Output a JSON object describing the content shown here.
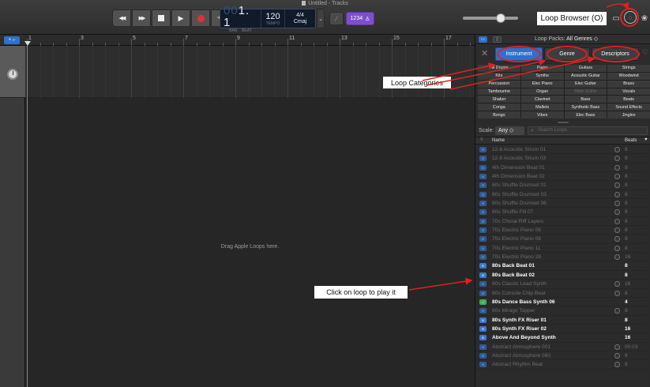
{
  "window": {
    "title": "Untitled - Tracks"
  },
  "transport": {
    "buttons": [
      "rewind",
      "fast-forward",
      "stop",
      "play",
      "record",
      "cycle"
    ],
    "glyphs": {
      "rewind": "◀◀",
      "fast_forward": "▶▶",
      "play": "▶",
      "cycle": "⟲"
    }
  },
  "lcd": {
    "position_dim": "00",
    "position_bar": "1",
    "position_beat": ". 1",
    "bar_label": "BAR",
    "beat_label": "BEAT",
    "tempo": "120",
    "tempo_label": "TEMPO",
    "time_sig": "4/4",
    "key": "Cmaj",
    "chevron": "⌄"
  },
  "toolbar": {
    "tuner_glyph": "⁄",
    "count_in": "1234",
    "metronome": "♙",
    "loop_browser_callout": "Loop Browser (O)",
    "notepad_glyph": "▭",
    "loop_browser_glyph": "◌",
    "media_glyph": "❀"
  },
  "ruler": {
    "marks": [
      "1",
      "3",
      "5",
      "7",
      "9",
      "11",
      "13",
      "15",
      "17"
    ]
  },
  "tracks": {
    "add_track": "+ ⌐",
    "drag_hint": "Drag Apple Loops here."
  },
  "annotations": {
    "loop_categories": "Loop Categories",
    "click_loop": "Click on loop to play it"
  },
  "browser": {
    "loop_packs_label": "Loop Packs:",
    "loop_packs_value": "All Genres ◇",
    "close_glyph": "✕",
    "heart_glyph": "♡",
    "tabs": [
      "Instrument",
      "Genre",
      "Descriptors"
    ],
    "categories": [
      "All Drums",
      "Piano",
      "Guitars",
      "Strings",
      "Kits",
      "Synths",
      "Acoustic Guitar",
      "Woodwind",
      "Percussion",
      "Elec Piano",
      "Elec Guitar",
      "Brass",
      "Tambourine",
      "Organ",
      "Slide Guitar",
      "Vocals",
      "Shaker",
      "Clavinet",
      "Bass",
      "Beats",
      "Conga",
      "Mallets",
      "Synthetic Bass",
      "Sound Effects",
      "Bongo",
      "Vibes",
      "Elec Bass",
      "Jingles"
    ],
    "dim_categories": [
      "Slide Guitar"
    ],
    "scale_label": "Scale:",
    "scale_value": "Any  ◇",
    "search_placeholder": "Search Loops",
    "search_glyph": "⌕",
    "columns": {
      "icon": "≡",
      "name": "Name",
      "beats": "Beats",
      "fav": "♥"
    },
    "loops": [
      {
        "name": "12-8 Acoustic Strum 01",
        "beats": "8",
        "download": true,
        "active": false,
        "icon": "wave"
      },
      {
        "name": "12-8 Acoustic Strum 03",
        "beats": "8",
        "download": true,
        "active": false,
        "icon": "wave"
      },
      {
        "name": "4th Dimension Beat 01",
        "beats": "8",
        "download": true,
        "active": false,
        "icon": "wave"
      },
      {
        "name": "4th Dimension Beat 02",
        "beats": "8",
        "download": true,
        "active": false,
        "icon": "wave"
      },
      {
        "name": "60s Shuffle Drumset 01",
        "beats": "8",
        "download": true,
        "active": false,
        "icon": "wave"
      },
      {
        "name": "60s Shuffle Drumset 03",
        "beats": "8",
        "download": true,
        "active": false,
        "icon": "wave"
      },
      {
        "name": "60s Shuffle Drumset 06",
        "beats": "8",
        "download": true,
        "active": false,
        "icon": "wave"
      },
      {
        "name": "60s Shuffle Fill 07",
        "beats": "8",
        "download": true,
        "active": false,
        "icon": "wave"
      },
      {
        "name": "70s Choral Riff Layers",
        "beats": "8",
        "download": true,
        "active": false,
        "icon": "wave"
      },
      {
        "name": "70s Electric Piano 06",
        "beats": "8",
        "download": true,
        "active": false,
        "icon": "wave"
      },
      {
        "name": "70s Electric Piano 08",
        "beats": "8",
        "download": true,
        "active": false,
        "icon": "wave"
      },
      {
        "name": "70s Electric Piano 11",
        "beats": "8",
        "download": true,
        "active": false,
        "icon": "wave"
      },
      {
        "name": "70s Electric Piano 28",
        "beats": "16",
        "download": true,
        "active": false,
        "icon": "wave"
      },
      {
        "name": "80s Back Beat 01",
        "beats": "8",
        "download": false,
        "active": true,
        "icon": "wave"
      },
      {
        "name": "80s Back Beat 02",
        "beats": "8",
        "download": false,
        "active": true,
        "icon": "wave"
      },
      {
        "name": "80s Classic Lead Synth",
        "beats": "16",
        "download": true,
        "active": false,
        "icon": "wave"
      },
      {
        "name": "80s Console Chip Beat",
        "beats": "8",
        "download": true,
        "active": false,
        "icon": "wave"
      },
      {
        "name": "80s Dance Bass Synth 06",
        "beats": "4",
        "download": false,
        "active": true,
        "icon": "note"
      },
      {
        "name": "80s Mirage Topper",
        "beats": "8",
        "download": true,
        "active": false,
        "icon": "wave"
      },
      {
        "name": "80s Synth FX Riser 01",
        "beats": "8",
        "download": false,
        "active": true,
        "icon": "wave"
      },
      {
        "name": "80s Synth FX Riser 02",
        "beats": "16",
        "download": false,
        "active": true,
        "icon": "wave"
      },
      {
        "name": "Above And Beyond Synth",
        "beats": "16",
        "download": false,
        "active": true,
        "icon": "wave"
      },
      {
        "name": "Abstract Atmosphere 001",
        "beats": "00:03",
        "download": true,
        "active": false,
        "icon": "wave"
      },
      {
        "name": "Abstract Atmosphere 080",
        "beats": "8",
        "download": true,
        "active": false,
        "icon": "wave"
      },
      {
        "name": "Abstract Rhythm Beat",
        "beats": "8",
        "download": true,
        "active": false,
        "icon": "wave"
      }
    ]
  },
  "colors": {
    "accent": "#2f6fce",
    "record": "#e0303a",
    "annotation": "#e02020",
    "count_in": "#7d4fc9"
  }
}
